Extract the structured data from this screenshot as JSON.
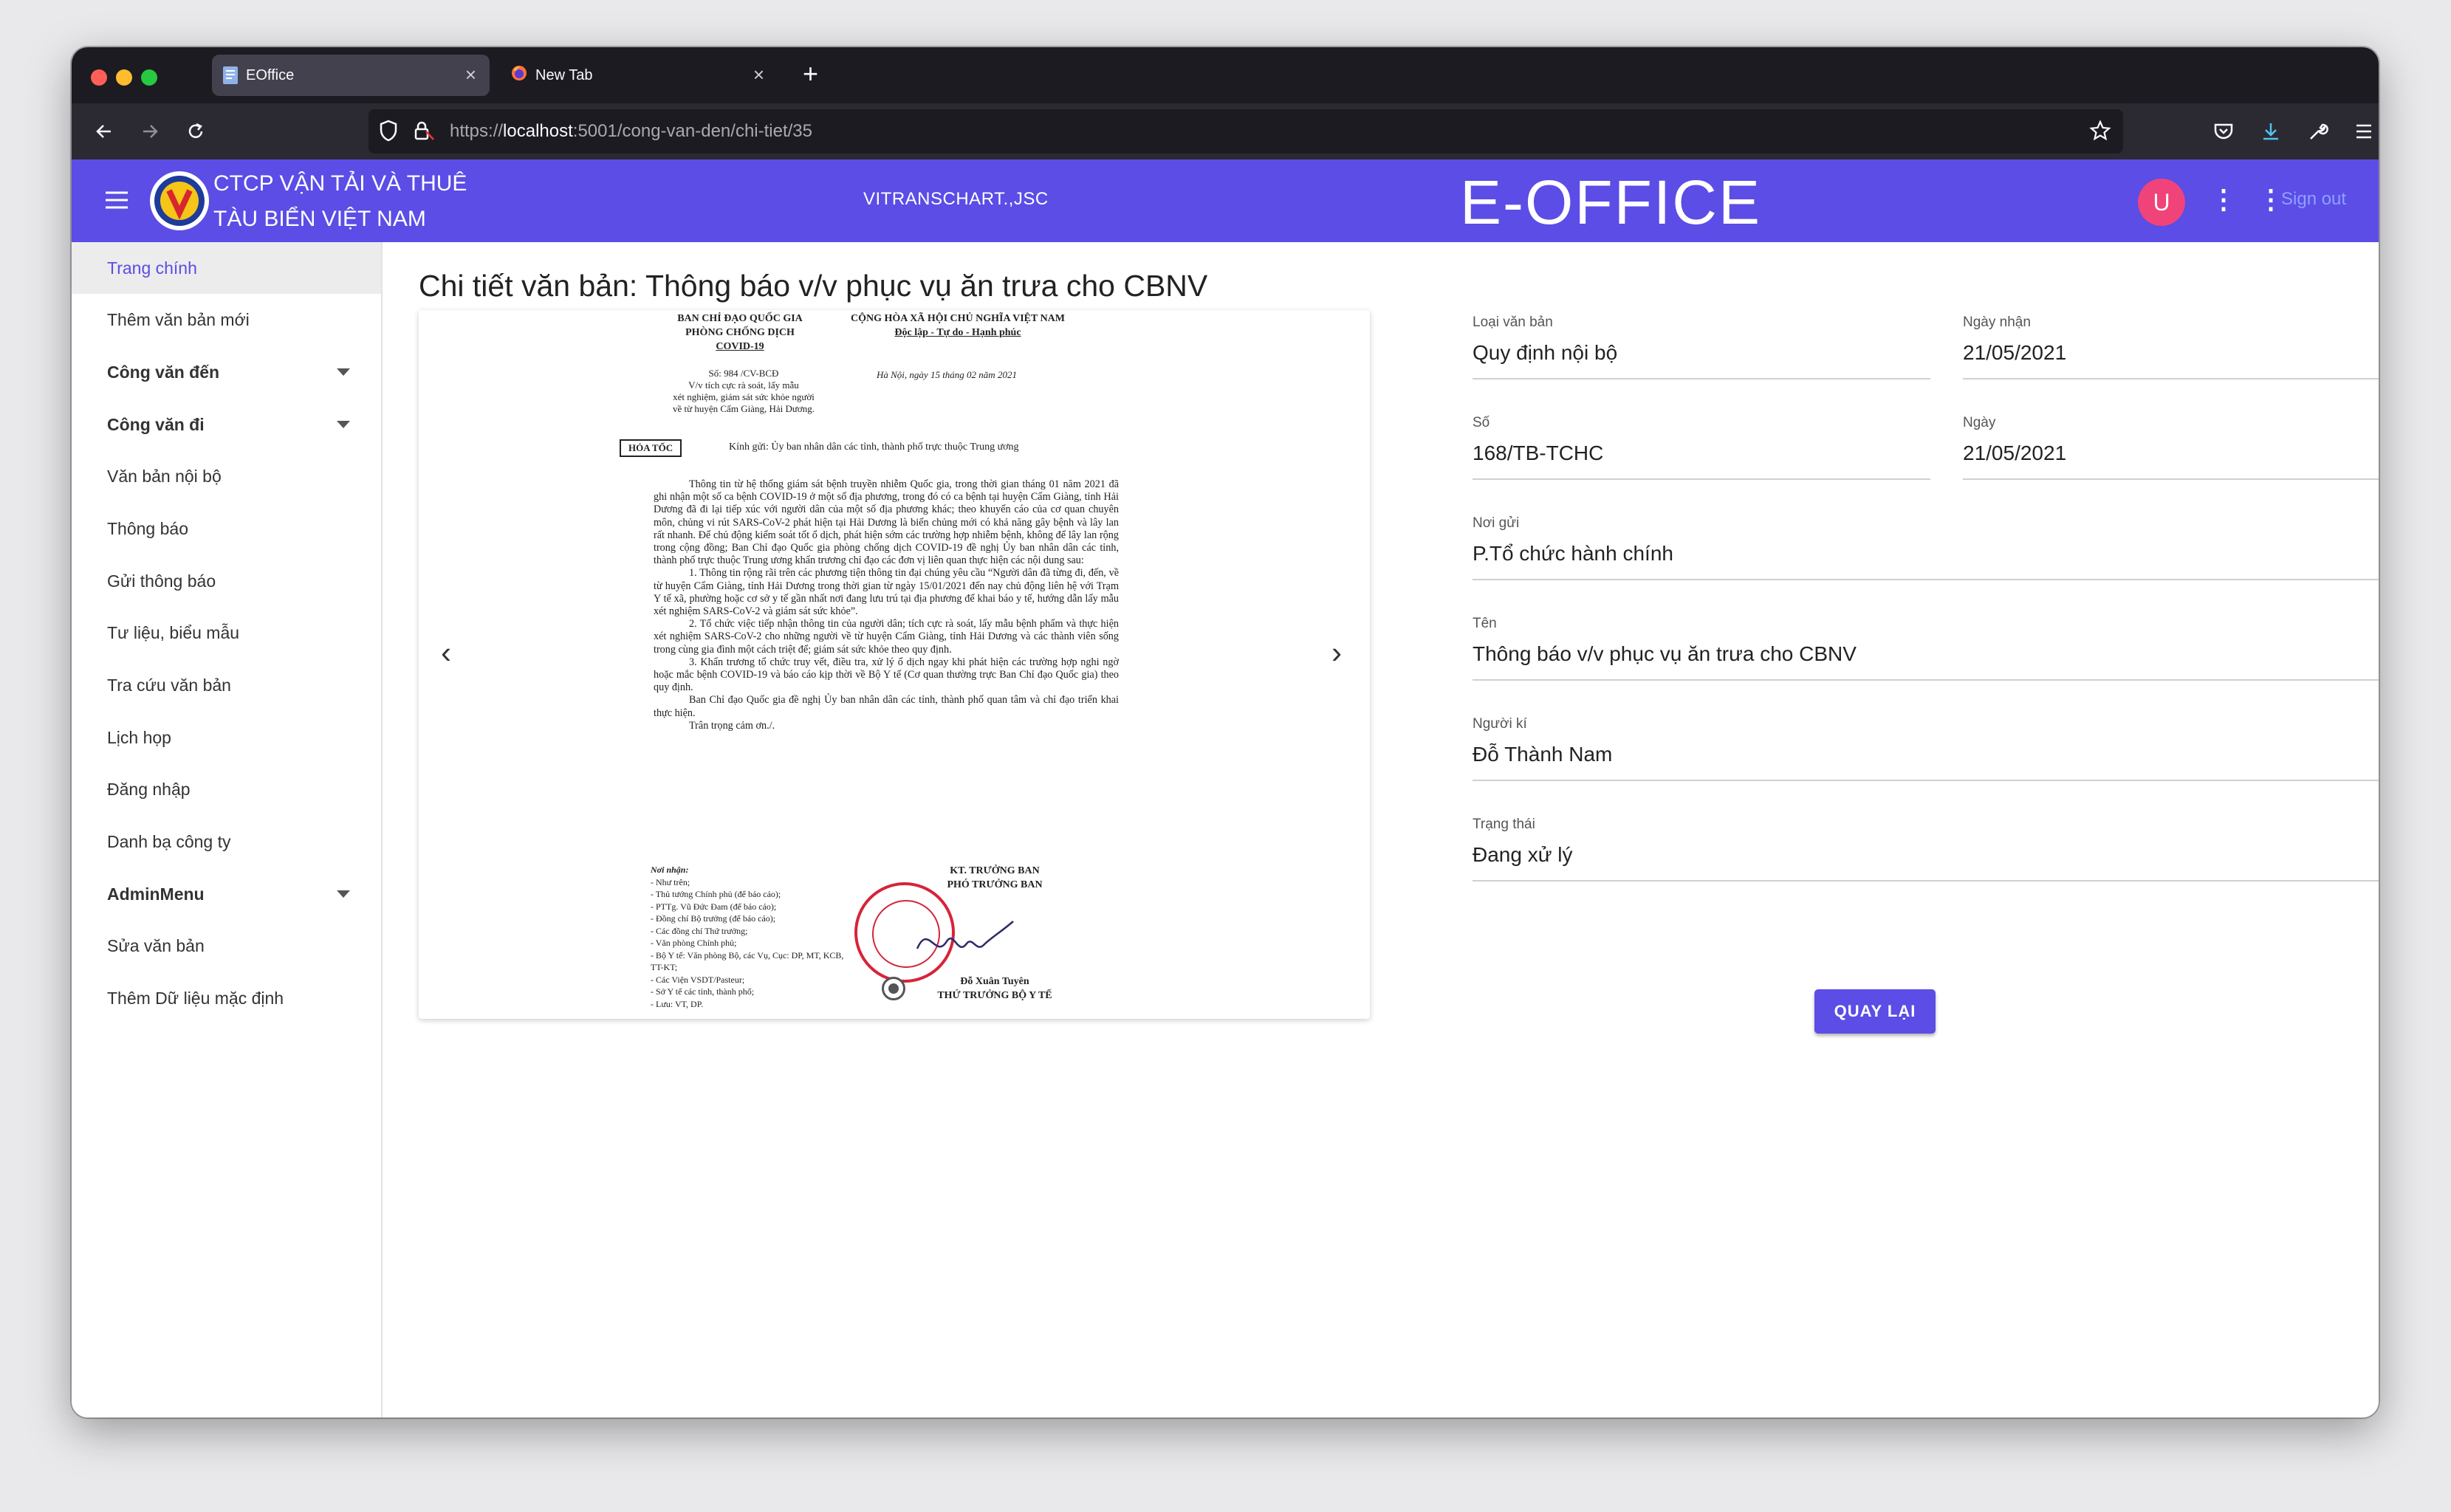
{
  "browser": {
    "tabs": [
      {
        "title": "EOffice"
      },
      {
        "title": "New Tab"
      }
    ],
    "url_prefix": "https://",
    "url_host": "localhost",
    "url_rest": ":5001/cong-van-den/chi-tiet/35"
  },
  "header": {
    "brand_line1": "CTCP VẬN TẢI VÀ THUÊ",
    "brand_line2": "TÀU BIỂN VIỆT NAM",
    "company": "VITRANSCHART.,JSC",
    "app_title": "E-OFFICE",
    "avatar_letter": "U",
    "sign_out": "Sign out",
    "color": "#5b4de6"
  },
  "sidebar": {
    "items": [
      {
        "label": "Trang chính"
      },
      {
        "label": "Thêm văn bản mới"
      },
      {
        "label": "Công văn đến"
      },
      {
        "label": "Công văn đi"
      },
      {
        "label": "Văn bản nội bộ"
      },
      {
        "label": "Thông báo"
      },
      {
        "label": "Gửi thông báo"
      },
      {
        "label": "Tư liệu, biểu mẫu"
      },
      {
        "label": "Tra cứu văn bản"
      },
      {
        "label": "Lịch họp"
      },
      {
        "label": "Đăng nhập"
      },
      {
        "label": "Danh bạ công ty"
      },
      {
        "label": "AdminMenu"
      },
      {
        "label": "Sửa văn bản"
      },
      {
        "label": "Thêm Dữ liệu mặc định"
      }
    ]
  },
  "main": {
    "page_title": "Chi tiết văn bản: Thông báo v/v phục vụ ăn trưa cho CBNV",
    "fields": {
      "loai_label": "Loại văn bản",
      "loai_value": "Quy định nội bộ",
      "ngaynhan_label": "Ngày nhận",
      "ngaynhan_value": "21/05/2021",
      "so_label": "Số",
      "so_value": "168/TB-TCHC",
      "ngay_label": "Ngày",
      "ngay_value": "21/05/2021",
      "noigui_label": "Nơi gửi",
      "noigui_value": "P.Tổ chức hành chính",
      "ten_label": "Tên",
      "ten_value": "Thông báo v/v phục vụ ăn trưa cho CBNV",
      "nguoiki_label": "Người kí",
      "nguoiki_value": "Đỗ Thành Nam",
      "trangthai_label": "Trạng thái",
      "trangthai_value": "Đang xử lý"
    },
    "back_button": "QUAY LẠI"
  },
  "document": {
    "left_header": [
      "BAN CHỈ ĐẠO QUỐC GIA",
      "PHÒNG CHỐNG DỊCH",
      "COVID-19"
    ],
    "right_header": [
      "CỘNG HÒA XÃ HỘI CHỦ NGHĨA VIỆT NAM",
      "Độc lập - Tự do - Hạnh phúc"
    ],
    "so": "Số: 984 /CV-BCĐ",
    "vv": [
      "V/v tích cực rà soát, lấy mẫu",
      "xét nghiệm, giám sát sức khỏe người",
      "về từ huyện Cẩm Giàng, Hải Dương."
    ],
    "date": "Hà Nội, ngày 15 tháng 02 năm 2021",
    "hoatoc": "HỎA TỐC",
    "kinhgui": "Kính gửi: Ủy ban nhân dân các tỉnh, thành phố trực thuộc Trung ương",
    "paragraphs": [
      "Thông tin từ hệ thống giám sát bệnh truyền nhiễm Quốc gia, trong thời gian tháng 01 năm 2021 đã ghi nhận một số ca bệnh COVID-19 ở một số địa phương, trong đó có ca bệnh tại huyện Cẩm Giàng, tỉnh Hải Dương đã đi lại tiếp xúc với người dân của một số địa phương khác; theo khuyến cáo của cơ quan chuyên môn, chủng vi rút SARS-CoV-2 phát hiện tại Hải Dương là biến chủng mới có khả năng gây bệnh và lây lan rất nhanh. Để chủ động kiểm soát tốt ổ dịch, phát hiện sớm các trường hợp nhiễm bệnh, không để lây lan rộng trong cộng đồng; Ban Chỉ đạo Quốc gia phòng chống dịch COVID-19 đề nghị Ủy ban nhân dân các tỉnh, thành phố trực thuộc Trung ương khẩn trương chỉ đạo các đơn vị liên quan thực hiện các nội dung sau:",
      "1. Thông tin rộng rãi trên các phương tiện thông tin đại chúng yêu cầu “Người dân đã từng đi, đến, về từ huyện Cẩm Giàng, tỉnh Hải Dương trong thời gian từ ngày 15/01/2021 đến nay chủ động liên hệ với Trạm Y tế xã, phường hoặc cơ sở y tế gần nhất nơi đang lưu trú tại địa phương để khai báo y tế, hướng dẫn lấy mẫu xét nghiệm SARS-CoV-2 và giám sát sức khỏe”.",
      "2. Tổ chức việc tiếp nhận thông tin của người dân; tích cực rà soát, lấy mẫu bệnh phẩm và thực hiện xét nghiệm SARS-CoV-2 cho những người về từ huyện Cẩm Giàng, tỉnh Hải Dương và các thành viên sống trong cùng gia đình một cách triệt để; giám sát sức khỏe theo quy định.",
      "3. Khẩn trương tổ chức truy vết, điều tra, xử lý ổ dịch ngay khi phát hiện các trường hợp nghi ngờ hoặc mắc bệnh COVID-19 và báo cáo kịp thời về Bộ Y tế (Cơ quan thường trực Ban Chỉ đạo Quốc gia) theo quy định.",
      "Ban Chỉ đạo Quốc gia đề nghị Ủy ban nhân dân các tỉnh, thành phố quan tâm và chỉ đạo triển khai thực hiện.",
      "Trân trọng cảm ơn./."
    ],
    "noinhan_title": "Nơi nhận:",
    "noinhan": [
      "- Như trên;",
      "- Thủ tướng Chính phủ (để báo cáo);",
      "- PTTg. Vũ Đức Đam (để báo cáo);",
      "- Đồng chí Bộ trưởng (để báo cáo);",
      "- Các đồng chí Thứ trưởng;",
      "- Văn phòng Chính phủ;",
      "- Bộ Y tế: Văn phòng Bộ, các Vụ, Cục: DP, MT, KCB,",
      "TT-KT;",
      "- Các Viện VSDT/Pasteur;",
      "- Sở Y tế các tỉnh, thành phố;",
      "- Lưu: VT, DP."
    ],
    "sign_title": [
      "KT. TRƯỞNG BAN",
      "PHÓ TRƯỞNG BAN"
    ],
    "signer": [
      "Đỗ Xuân Tuyên",
      "THỨ TRƯỞNG BỘ Y TẾ"
    ]
  }
}
